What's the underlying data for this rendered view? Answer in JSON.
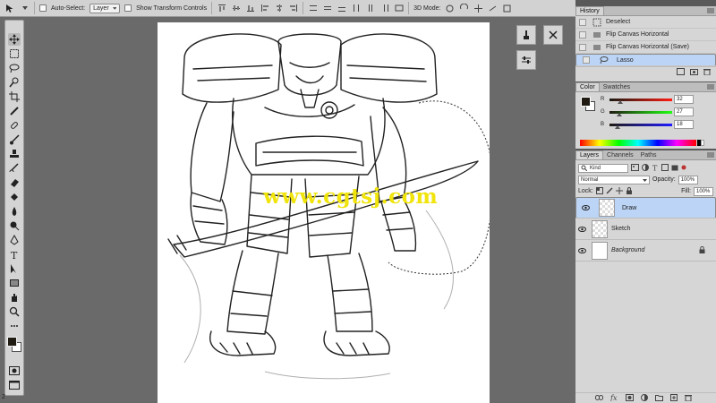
{
  "options_bar": {
    "auto_select_label": "Auto-Select:",
    "auto_select_value": "Layer",
    "show_transform_label": "Show Transform Controls",
    "mode_label": "3D Mode:"
  },
  "canvas": {
    "watermark": "www.cgtsj.com"
  },
  "status": {
    "bottom_number": "2"
  },
  "history": {
    "tab": "History",
    "items": [
      {
        "label": "Deselect"
      },
      {
        "label": "Flip Canvas Horizontal"
      },
      {
        "label": "Flip Canvas Horizontal (Save)"
      },
      {
        "label": "Lasso"
      }
    ]
  },
  "color": {
    "tabs": [
      "Color",
      "Swatches"
    ],
    "r_label": "R",
    "g_label": "G",
    "b_label": "B",
    "r": "32",
    "g": "27",
    "b": "18",
    "foreground": "#201b12"
  },
  "layers": {
    "tabs": [
      "Layers",
      "Channels",
      "Paths"
    ],
    "kind": "Kind",
    "blend_mode": "Normal",
    "opacity_label": "Opacity:",
    "opacity": "100%",
    "lock_label": "Lock:",
    "fill_label": "Fill:",
    "fill": "100%",
    "items": [
      {
        "name": "Draw"
      },
      {
        "name": "Sketch"
      },
      {
        "name": "Background"
      }
    ]
  },
  "colors": {
    "selection": "#bcd4f5",
    "panel_bg": "#d6d6d6",
    "workspace": "#6a6a6a",
    "watermark": "#f0e40a"
  }
}
